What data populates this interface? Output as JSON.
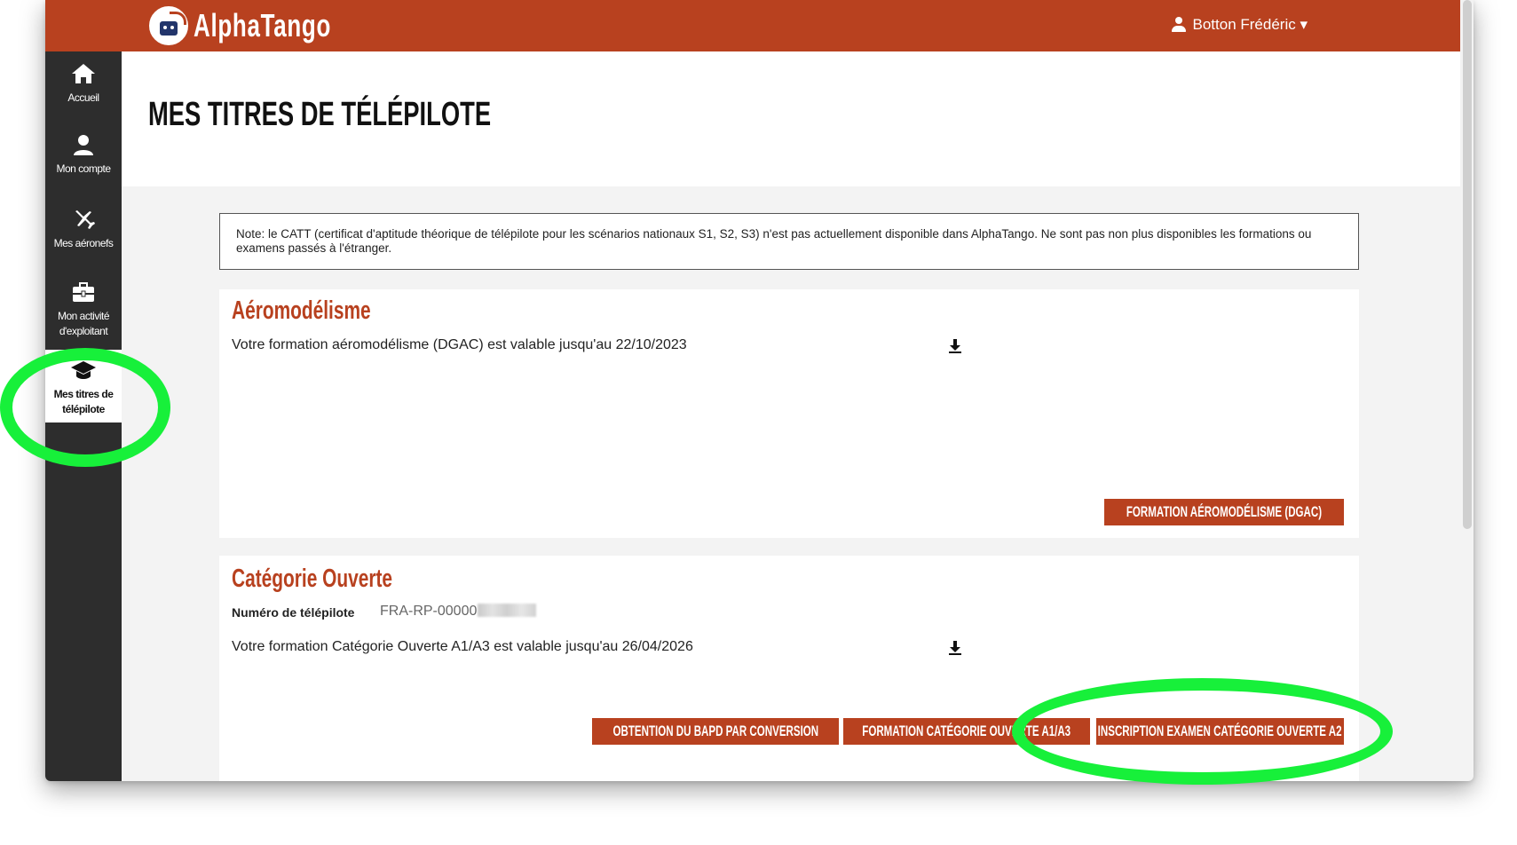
{
  "app": {
    "name": "AlphaTango"
  },
  "user": {
    "name": "Botton Frédéric ▾"
  },
  "sidebar": {
    "items": [
      {
        "label": "Accueil",
        "icon": "home-icon"
      },
      {
        "label": "Mon compte",
        "icon": "user-icon"
      },
      {
        "label": "Mes aéronefs",
        "icon": "drone-icon"
      },
      {
        "label": "Mon activité d'exploitant",
        "icon": "briefcase-icon"
      },
      {
        "label": "Mes titres de télépilote",
        "icon": "graduation-cap-icon",
        "active": true
      }
    ]
  },
  "page": {
    "title": "MES TITRES DE TÉLÉPILOTE"
  },
  "note": "Note: le CATT (certificat d'aptitude théorique de télépilote pour les scénarios nationaux S1, S2, S3) n'est pas actuellement disponible dans AlphaTango. Ne sont pas non plus disponibles les formations ou examens passés à l'étranger.",
  "aeromodelisme": {
    "title": "Aéromodélisme",
    "validity": "Votre formation aéromodélisme (DGAC) est valable jusqu'au 22/10/2023",
    "button": "FORMATION AÉROMODÉLISME (DGAC)"
  },
  "categorie_ouverte": {
    "title": "Catégorie Ouverte",
    "pilot_label": "Numéro de télépilote",
    "pilot_number": "FRA-RP-00000",
    "validity": "Votre formation Catégorie Ouverte A1/A3 est valable jusqu'au 26/04/2026",
    "buttons": [
      "OBTENTION DU BAPD PAR CONVERSION",
      "FORMATION CATÉGORIE OUVERTE A1/A3",
      "INSCRIPTION EXAMEN CATÉGORIE OUVERTE A2"
    ]
  },
  "colors": {
    "brand": "#b8411f",
    "sidebar": "#2d2d2d",
    "highlight": "#17f03a"
  }
}
